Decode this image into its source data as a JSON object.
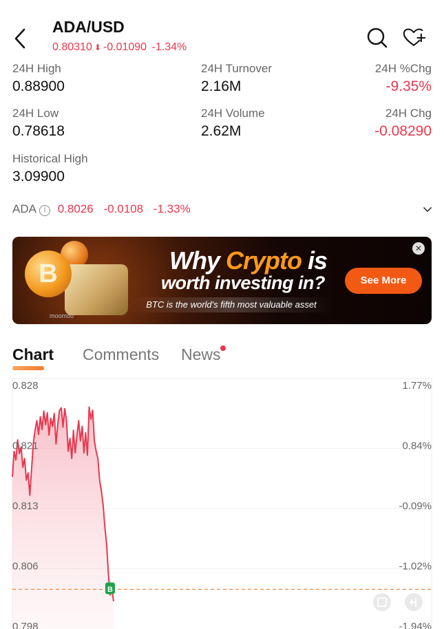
{
  "header": {
    "pair": "ADA/USD",
    "price": "0.80310",
    "change": "-0.01090",
    "change_pct": "-1.34%",
    "icons": {
      "back": "chevron-left-icon",
      "search": "search-icon",
      "watchlist": "heart-add-icon"
    }
  },
  "stats": [
    {
      "label": "24H High",
      "value": "0.88900"
    },
    {
      "label": "24H Turnover",
      "value": "2.16M"
    },
    {
      "label": "24H %Chg",
      "value": "-9.35%"
    },
    {
      "label": "24H Low",
      "value": "0.78618"
    },
    {
      "label": "24H Volume",
      "value": "2.62M"
    },
    {
      "label": "24H Chg",
      "value": "-0.08290"
    },
    {
      "label": "Historical High",
      "value": "3.09900"
    }
  ],
  "ada_row": {
    "symbol": "ADA",
    "price": "0.8026",
    "change": "-0.0108",
    "change_pct": "-1.33%"
  },
  "banner": {
    "title_pre": "Why",
    "title_highlight": "Crypto",
    "title_post": "is",
    "subtitle": "worth investing in?",
    "caption": "BTC is the world's fifth most valuable asset",
    "cta": "See More",
    "brand": "moomoo",
    "coin_letter": "B"
  },
  "tabs": [
    "Chart",
    "Comments",
    "News"
  ],
  "chart_data": {
    "type": "line",
    "left_axis": [
      "0.828",
      "0.821",
      "0.813",
      "0.806",
      "0.798"
    ],
    "right_axis": [
      "1.77%",
      "0.84%",
      "-0.09%",
      "-1.02%",
      "-1.94%"
    ],
    "ylim": [
      0.798,
      0.828
    ],
    "reference_price": 0.8026,
    "buy_marker": "B",
    "series": [
      {
        "values": [
          0.8166,
          0.8198,
          0.8187,
          0.8212,
          0.8195,
          0.8203,
          0.8178,
          0.8189,
          0.8162,
          0.8171,
          0.8143,
          0.8176,
          0.8208,
          0.8224,
          0.8236,
          0.8219,
          0.8241,
          0.8225,
          0.8248,
          0.8231,
          0.8246,
          0.8218,
          0.8239,
          0.8229,
          0.8245,
          0.8207,
          0.8231,
          0.8249,
          0.8252,
          0.8228,
          0.8251,
          0.8236,
          0.8198,
          0.8214,
          0.8189,
          0.8224,
          0.8196,
          0.8218,
          0.8236,
          0.8211,
          0.8229,
          0.8196,
          0.8221,
          0.8193,
          0.8253,
          0.8238,
          0.8249,
          0.8211,
          0.8198,
          0.8189,
          0.8162,
          0.8148,
          0.8131,
          0.8104,
          0.8082,
          0.8046,
          0.8019,
          0.8026,
          0.8011
        ]
      }
    ]
  },
  "chart_icons": [
    "fullscreen-icon",
    "collapse-icon"
  ],
  "colors": {
    "down": "#e8384f",
    "accent": "#f37b2b",
    "buy_marker": "#1fa34a"
  }
}
